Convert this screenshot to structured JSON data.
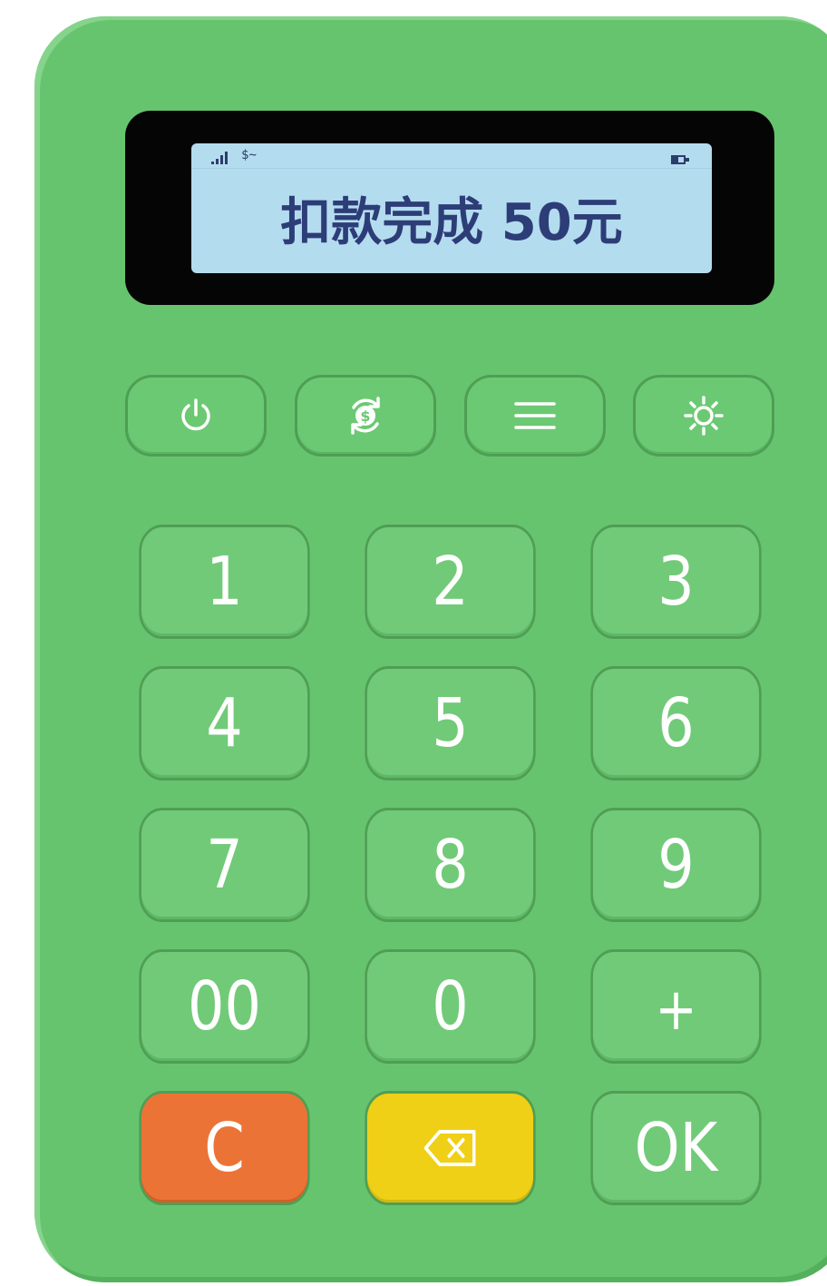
{
  "screen": {
    "status_bar": {
      "signal_icon": "signal-strength-icon",
      "payment_icon": "dollar-wave-icon",
      "payment_symbol": "$",
      "battery_icon": "battery-icon"
    },
    "message": "扣款完成 50元"
  },
  "function_keys": [
    {
      "id": "power",
      "icon": "power-icon"
    },
    {
      "id": "refund",
      "icon": "dollar-refresh-icon"
    },
    {
      "id": "menu",
      "icon": "menu-icon"
    },
    {
      "id": "brightness",
      "icon": "sun-icon"
    }
  ],
  "keypad": {
    "row1": [
      "1",
      "2",
      "3"
    ],
    "row2": [
      "4",
      "5",
      "6"
    ],
    "row3": [
      "7",
      "8",
      "9"
    ],
    "row4": [
      "00",
      "0",
      "+"
    ],
    "row5": {
      "clear": "C",
      "backspace_icon": "backspace-icon",
      "ok": "OK"
    }
  },
  "colors": {
    "body": "#66c46f",
    "key": "#71ca78",
    "lcd": "#b4dcef",
    "lcd_text": "#2d3d77",
    "clear_key": "#ec7336",
    "backspace_key": "#efd016"
  }
}
